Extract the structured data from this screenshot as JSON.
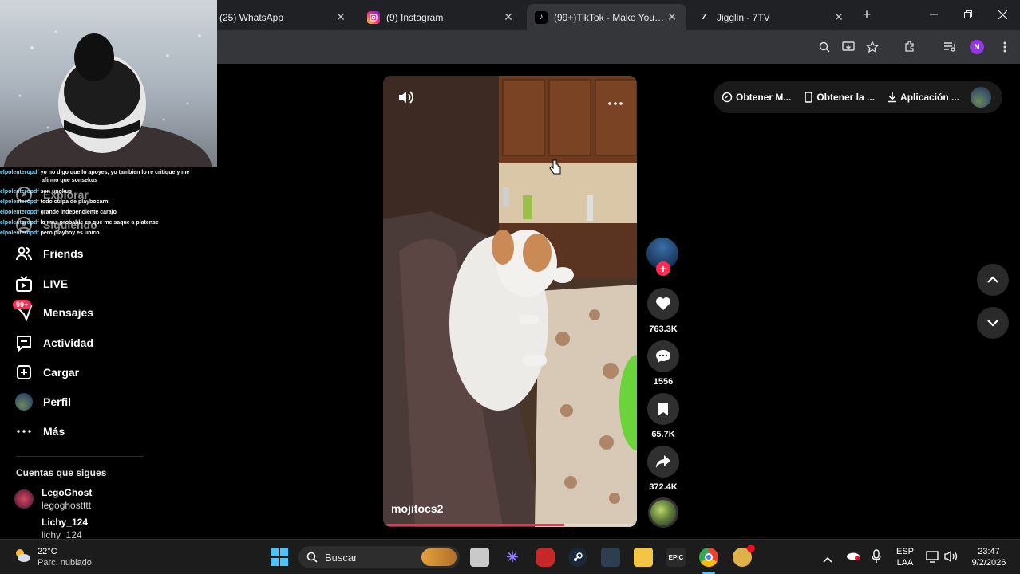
{
  "browser": {
    "tabs": [
      {
        "title": "(25) WhatsApp",
        "active": false
      },
      {
        "title": "(9) Instagram",
        "active": false
      },
      {
        "title": "(99+)TikTok - Make Your Day",
        "active": true
      },
      {
        "title": "Jigglin - 7TV",
        "active": false
      }
    ],
    "new_tab_label": "+",
    "profile_initial": "N"
  },
  "chat_overlay": [
    {
      "user": "elpolenteropdf",
      "message": "yo no digo que lo apoyes, yo tambien lo re critique y me"
    },
    {
      "user": "",
      "message": "afirmo que sonsekus"
    },
    {
      "user": "elpolenteropdf",
      "message": "son unokus"
    },
    {
      "user": "elpolenteropdf",
      "message": "todo culpa de playbocarni"
    },
    {
      "user": "elpolenteropdf",
      "message": "grande independiente carajo"
    },
    {
      "user": "elpolenteropdf",
      "message": "lo mas probable es que me saque a platense"
    },
    {
      "user": "elpolenteropdf",
      "message": "pero playboy es unico"
    }
  ],
  "sidebar": {
    "items": [
      {
        "label": "Explorar",
        "icon": "compass-icon"
      },
      {
        "label": "Siguiendo",
        "icon": "following-icon"
      },
      {
        "label": "Friends",
        "icon": "friends-icon"
      },
      {
        "label": "LIVE",
        "icon": "live-icon"
      },
      {
        "label": "Mensajes",
        "icon": "messages-icon",
        "badge": "99+"
      },
      {
        "label": "Actividad",
        "icon": "activity-icon"
      },
      {
        "label": "Cargar",
        "icon": "upload-icon"
      },
      {
        "label": "Perfil",
        "icon": "profile-avatar"
      },
      {
        "label": "Más",
        "icon": "more-icon"
      }
    ],
    "following_title": "Cuentas que sigues",
    "following": [
      {
        "name": "LegoGhost",
        "handle": "legoghostttt"
      },
      {
        "name": "Lichy_124",
        "handle": "lichy_124"
      }
    ]
  },
  "video": {
    "author": "mojitocs2",
    "progress": 0.72,
    "likes": "763.3K",
    "comments": "1556",
    "saves": "65.7K",
    "shares": "372.4K"
  },
  "top_pill": {
    "items": [
      "Obtener M...",
      "Obtener la ...",
      "Aplicación ..."
    ]
  },
  "taskbar": {
    "weather_temp": "22°C",
    "weather_desc": "Parc. nublado",
    "search_placeholder": "Buscar",
    "lang_top": "ESP",
    "lang_bottom": "LAA",
    "time": "23:47",
    "date": "9/2/2026",
    "epic_label": "EPIC"
  },
  "colors": {
    "tiktok_red": "#fe2c55",
    "taskbar_bg": "#1c1c1c",
    "chrome_bg": "#202124"
  }
}
